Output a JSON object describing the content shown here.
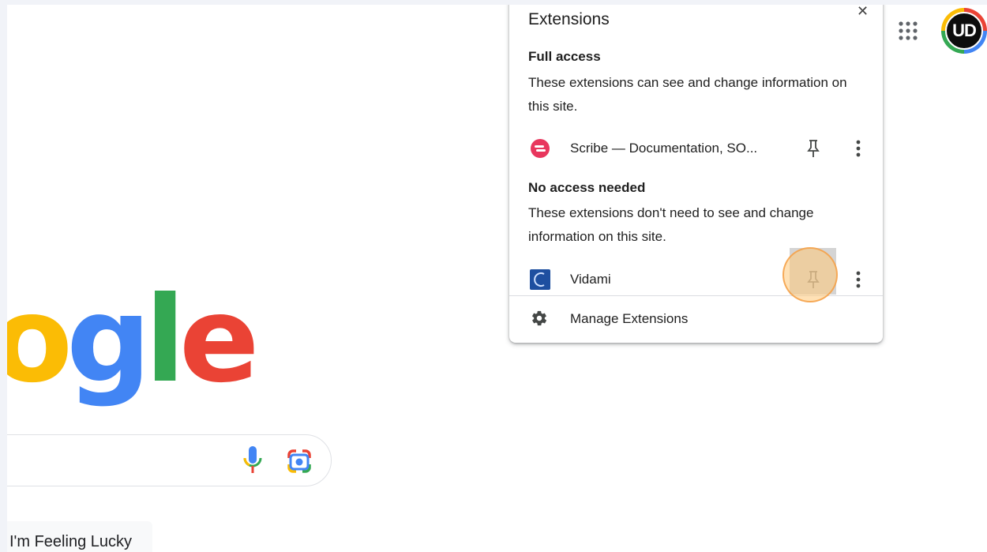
{
  "header": {
    "apps_icon": "apps-grid-icon",
    "avatar_text": "UD"
  },
  "logo": {
    "partial_text": [
      "o",
      "g",
      "l",
      "e"
    ],
    "colors": {
      "blue": "#4285f4",
      "red": "#ea4335",
      "yellow": "#fbbc05",
      "green": "#34a853"
    }
  },
  "search": {
    "mic_icon": "microphone-icon",
    "lens_icon": "google-lens-icon",
    "lucky_label": "I'm Feeling Lucky"
  },
  "extensions_popup": {
    "title": "Extensions",
    "full_access": {
      "heading": "Full access",
      "description": "These extensions can see and change information on this site.",
      "items": [
        {
          "name": "Scribe — Documentation, SO...",
          "icon": "scribe-icon",
          "icon_color": "#e8365d"
        }
      ]
    },
    "no_access": {
      "heading": "No access needed",
      "description": "These extensions don't need to see and change information on this site.",
      "items": [
        {
          "name": "Vidami",
          "icon": "vidami-icon",
          "icon_color": "#1e4fa0"
        }
      ]
    },
    "manage_label": "Manage Extensions"
  }
}
